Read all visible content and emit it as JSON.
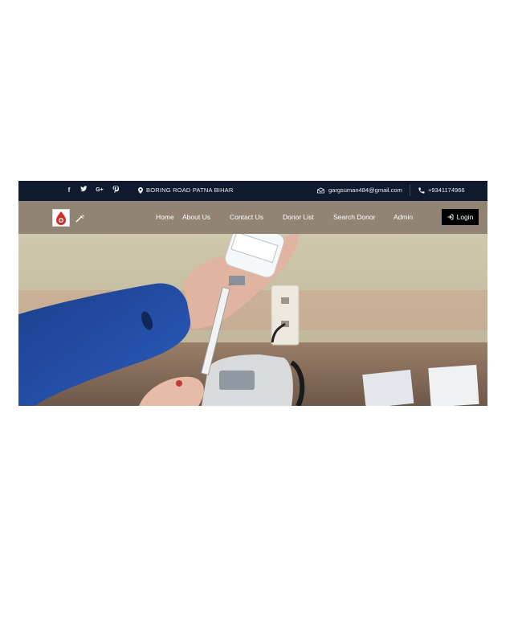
{
  "topbar": {
    "social_icons": [
      "facebook-icon",
      "twitter-icon",
      "google-plus-icon",
      "pinterest-icon"
    ],
    "social_glyphs": [
      "f",
      "🐦",
      "G+",
      "P"
    ],
    "address": "BORING ROAD PATNA BIHAR",
    "email": "gargsuman484@gmail.com",
    "phone": "+9341174966"
  },
  "nav": {
    "items": [
      "Home",
      "About Us",
      "Contact Us",
      "Donor List",
      "Search Donor",
      "Admin"
    ],
    "login_label": "Login"
  },
  "colors": {
    "topbar_bg": "#0f1a2e",
    "navbar_bg": "#8c7f71",
    "login_bg": "#000000",
    "logo_red": "#d62b2b"
  }
}
